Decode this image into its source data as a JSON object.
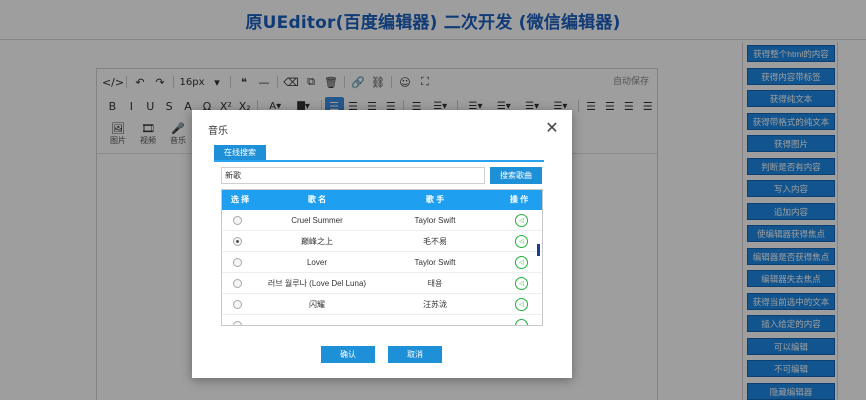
{
  "page": {
    "title": "原UEditor(百度编辑器) 二次开发 (微信编辑器)"
  },
  "toolbar": {
    "row1": [
      "</>",
      "↶",
      "↷",
      "16px",
      "▾",
      "❝",
      "—",
      "⌫",
      "⧉",
      "🗑",
      "🔗",
      "⛓",
      "☺",
      "⛶"
    ],
    "row2": [
      "B",
      "I",
      "U",
      "S",
      "A",
      "Ω",
      "X²",
      "X₂",
      "A▾",
      "▇▾",
      "☰",
      "☰",
      "☰",
      "☰",
      "☰",
      "☰▾",
      "☰▾",
      "☰▾",
      "☰▾",
      "☰▾",
      "☰",
      "☰",
      "☰",
      "☰"
    ],
    "autosave": "自动保存",
    "media": [
      {
        "icon": "🖼",
        "label": "图片"
      },
      {
        "icon": "🎞",
        "label": "视频"
      },
      {
        "icon": "🎤",
        "label": "音乐"
      }
    ]
  },
  "sidebar": {
    "items": [
      "获得整个html的内容",
      "获得内容带标签",
      "获得纯文本",
      "获得带格式的纯文本",
      "获得图片",
      "判断是否有内容",
      "写入内容",
      "追加内容",
      "使编辑器获得焦点",
      "编辑器是否获得焦点",
      "编辑器失去焦点",
      "获得当前选中的文本",
      "插入给定的内容",
      "可以编辑",
      "不可编辑",
      "隐藏编辑器"
    ]
  },
  "dialog": {
    "title": "音乐",
    "close": "✕",
    "tab": "在线搜索",
    "search_value": "新歌",
    "search_button": "搜索歌曲",
    "columns": [
      "选 择",
      "歌 名",
      "歌 手",
      "操 作"
    ],
    "rows": [
      {
        "song": "Cruel Summer",
        "artist": "Taylor Swift",
        "selected": false
      },
      {
        "song": "巅峰之上",
        "artist": "毛不易",
        "selected": true
      },
      {
        "song": "Lover",
        "artist": "Taylor Swift",
        "selected": false
      },
      {
        "song": "러브 월루나 (Love Del Luna)",
        "artist": "태용",
        "selected": false
      },
      {
        "song": "闪耀",
        "artist": "汪苏泷",
        "selected": false
      }
    ],
    "play_icon": "◁",
    "ok_button": "确认",
    "cancel_button": "取消"
  }
}
